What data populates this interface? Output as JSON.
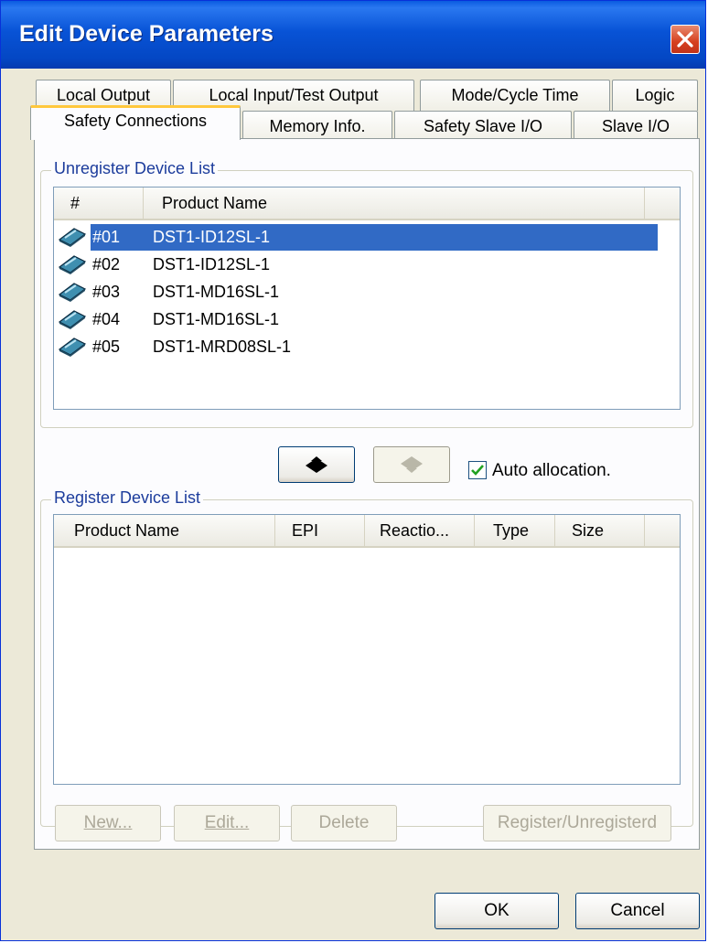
{
  "window": {
    "title": "Edit Device Parameters"
  },
  "tabs": {
    "row1": [
      "Local Output",
      "Local Input/Test Output",
      "Mode/Cycle Time",
      "Logic"
    ],
    "row2": [
      "Safety Connections",
      "Memory Info.",
      "Safety Slave I/O",
      "Slave I/O"
    ],
    "active": "Safety Connections"
  },
  "unregister": {
    "legend": "Unregister Device List",
    "columns": [
      "#",
      "Product Name"
    ],
    "rows": [
      {
        "num": "#01",
        "name": "DST1-ID12SL-1",
        "selected": true
      },
      {
        "num": "#02",
        "name": "DST1-ID12SL-1",
        "selected": false
      },
      {
        "num": "#03",
        "name": "DST1-MD16SL-1",
        "selected": false
      },
      {
        "num": "#04",
        "name": "DST1-MD16SL-1",
        "selected": false
      },
      {
        "num": "#05",
        "name": "DST1-MRD08SL-1",
        "selected": false
      }
    ]
  },
  "move": {
    "auto_allocation_label": "Auto allocation.",
    "auto_allocation_checked": true
  },
  "register": {
    "legend": "Register Device List",
    "columns": [
      "Product Name",
      "EPI",
      "Reactio...",
      "Type",
      "Size"
    ],
    "rows": []
  },
  "panel_buttons": {
    "new": "New...",
    "edit": "Edit...",
    "delete": "Delete",
    "register_unregister": "Register/Unregisterd"
  },
  "dialog_buttons": {
    "ok": "OK",
    "cancel": "Cancel"
  },
  "colors": {
    "titlebar": "#0853d6",
    "selection": "#316ac5",
    "legend": "#1c3c9c",
    "active_tab_accent": "#ffc83c"
  }
}
